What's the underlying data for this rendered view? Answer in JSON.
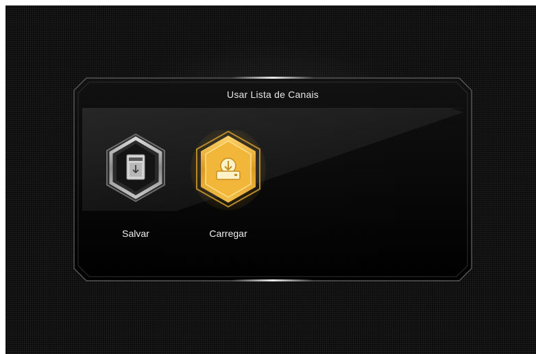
{
  "dialog": {
    "title": "Usar Lista de Canais"
  },
  "options": [
    {
      "label": "Salvar",
      "icon": "save-to-storage-icon",
      "selected": false
    },
    {
      "label": "Carregar",
      "icon": "load-from-storage-icon",
      "selected": true
    }
  ],
  "colors": {
    "accent": "#f0b43a",
    "background": "#0b0b0b",
    "text": "#f0f0f0"
  }
}
